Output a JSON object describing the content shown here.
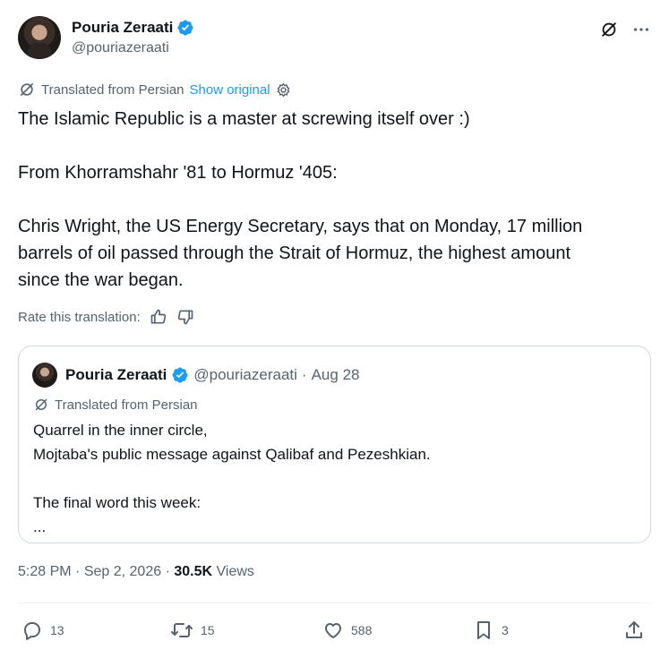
{
  "author": {
    "display_name": "Pouria Zeraati",
    "handle": "@pouriazeraati"
  },
  "translation": {
    "label": "Translated from Persian",
    "show_original": "Show original"
  },
  "tweet": {
    "text": "The Islamic Republic is a master at screwing itself over :)\n\nFrom Khorramshahr '81 to Hormuz '405:\n\nChris Wright, the US Energy Secretary, says that on Monday, 17 million\nbarrels of oil passed through the Strait of Hormuz, the highest amount\nsince the war began.",
    "rate_label": "Rate this translation:"
  },
  "quote": {
    "display_name": "Pouria Zeraati",
    "handle": "@pouriazeraati",
    "separator": "·",
    "date": "Aug 28",
    "translated_label": "Translated from Persian",
    "text": "Quarrel in the inner circle,\nMojtaba's public message against Qalibaf and Pezeshkian.\n\nThe final word this week:\n..."
  },
  "meta": {
    "time": "5:28 PM",
    "date": "Sep 2, 2026",
    "views_count": "30.5K",
    "views_label": "Views"
  },
  "actions": {
    "replies": "13",
    "reposts": "15",
    "likes": "588",
    "bookmarks": "3"
  },
  "colors": {
    "verified": "#1d9bf0",
    "link": "#1d9bf0",
    "secondary_text": "#536471",
    "primary_text": "#0f1419",
    "border": "#cfd9de"
  },
  "icons": [
    "grok-icon",
    "more-icon",
    "translate-icon",
    "settings-gear-icon",
    "thumbs-up-icon",
    "thumbs-down-icon",
    "reply-icon",
    "repost-icon",
    "like-icon",
    "bookmark-icon",
    "share-icon",
    "verified-badge-icon"
  ]
}
